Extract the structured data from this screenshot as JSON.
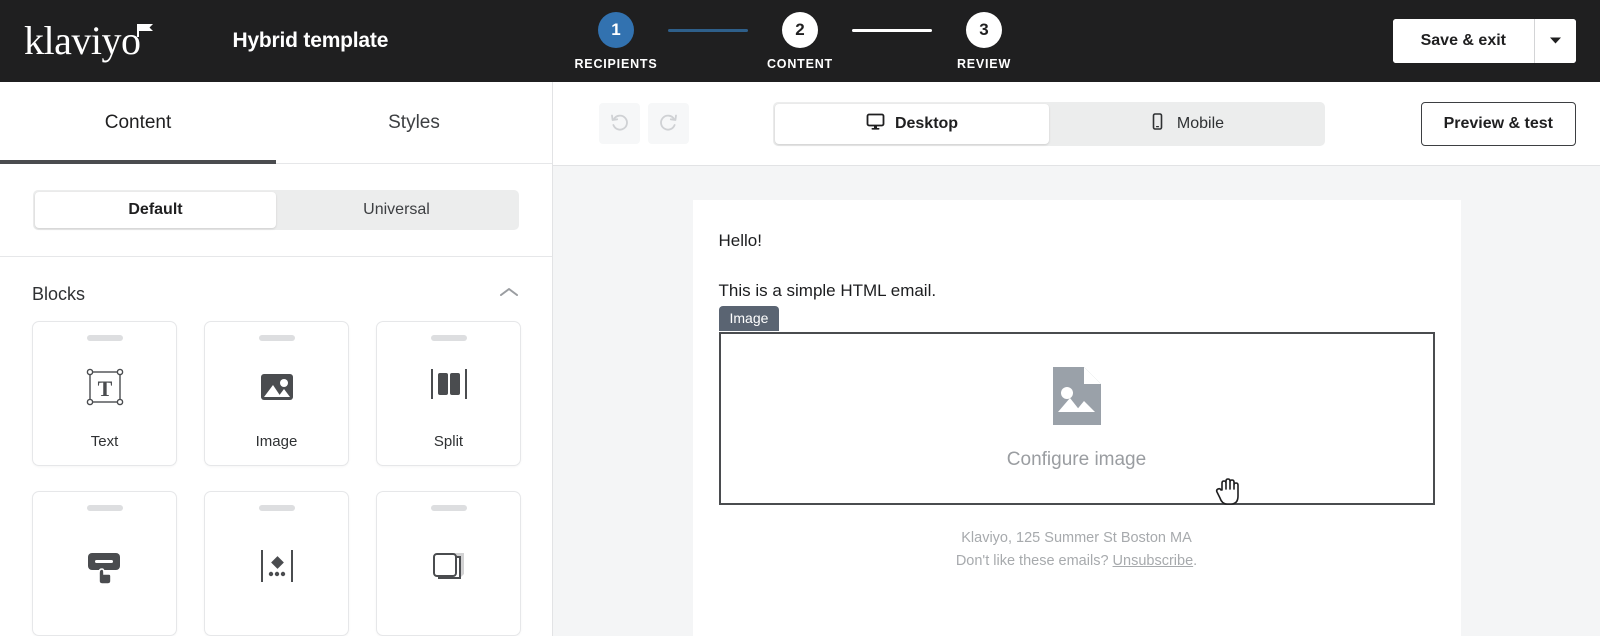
{
  "topbar": {
    "logo_text": "klaviyo",
    "logo_icon": "flag-icon",
    "document_title": "Hybrid template",
    "steps": [
      {
        "number": "1",
        "label": "RECIPIENTS",
        "state": "active"
      },
      {
        "number": "2",
        "label": "CONTENT",
        "state": "idle"
      },
      {
        "number": "3",
        "label": "REVIEW",
        "state": "idle"
      }
    ],
    "connectors": [
      "done",
      "todo"
    ],
    "save_label": "Save & exit",
    "save_caret_icon": "chevron-down-icon",
    "colors": {
      "bar_background": "#1f1f20",
      "active_step": "#3272b0",
      "connector_done": "#2e5f8a",
      "connector_todo": "#ffffff"
    }
  },
  "left_panel": {
    "tabs": [
      {
        "label": "Content",
        "active": true
      },
      {
        "label": "Styles",
        "active": false
      }
    ],
    "segmented": [
      {
        "label": "Default",
        "active": true
      },
      {
        "label": "Universal",
        "active": false
      }
    ],
    "section": {
      "title": "Blocks",
      "collapse_icon": "chevron-up-icon"
    },
    "blocks": [
      {
        "label": "Text",
        "icon": "text-block-icon"
      },
      {
        "label": "Image",
        "icon": "image-block-icon"
      },
      {
        "label": "Split",
        "icon": "split-block-icon"
      },
      {
        "label": "",
        "icon": "button-block-icon"
      },
      {
        "label": "",
        "icon": "divider-block-icon"
      },
      {
        "label": "",
        "icon": "table-block-icon"
      }
    ]
  },
  "canvas_toolbar": {
    "undo_icon": "undo-icon",
    "redo_icon": "redo-icon",
    "devices": [
      {
        "label": "Desktop",
        "icon": "monitor-icon",
        "active": true
      },
      {
        "label": "Mobile",
        "icon": "phone-icon",
        "active": false
      }
    ],
    "preview_label": "Preview & test"
  },
  "email": {
    "paragraphs": [
      "Hello!",
      "This is a simple HTML email."
    ],
    "image_block": {
      "badge": "Image",
      "placeholder_icon": "image-file-icon",
      "placeholder_label": "Configure image"
    },
    "footer": {
      "address": "Klaviyo, 125 Summer St Boston MA",
      "unsubscribe_prefix": "Don't like these emails? ",
      "unsubscribe_link": "Unsubscribe",
      "unsubscribe_suffix": "."
    },
    "cursor_icon": "grab-hand-cursor"
  }
}
